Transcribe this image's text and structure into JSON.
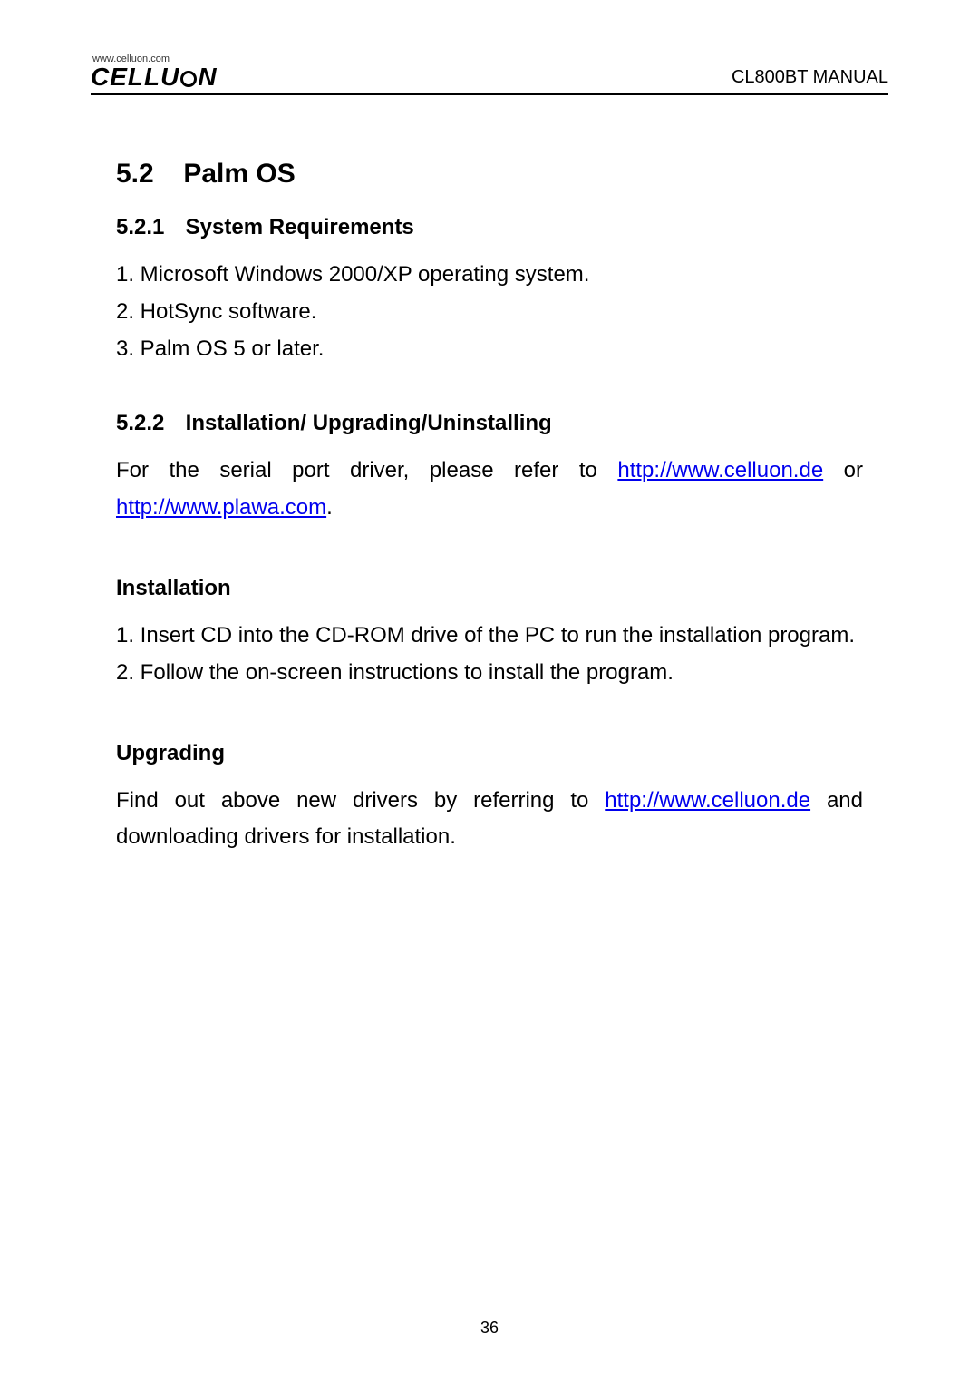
{
  "header": {
    "logo_url": "www.celluon.com",
    "logo_part1": "CELLU",
    "logo_part2": "N",
    "doc_title": "CL800BT MANUAL"
  },
  "section": {
    "number": "5.2",
    "title": "Palm OS"
  },
  "sub1": {
    "number": "5.2.1",
    "title": "System Requirements",
    "items": [
      "1. Microsoft Windows 2000/XP operating system.",
      "2. HotSync software.",
      "3. Palm OS 5 or later."
    ]
  },
  "sub2": {
    "number": "5.2.2",
    "title": "Installation/ Upgrading/Uninstalling",
    "intro_prefix": "For the serial port driver, please refer to ",
    "link1_text": "http://www.celluon.de",
    "intro_middle": " or ",
    "link2_text": "http://www.plawa.com",
    "intro_suffix": "."
  },
  "installation": {
    "heading": "Installation",
    "items": [
      "1. Insert CD into the CD-ROM drive of the PC to run the installation program.",
      "2. Follow the on-screen instructions to install the program."
    ]
  },
  "upgrading": {
    "heading": "Upgrading",
    "prefix": "Find out above new drivers by referring to ",
    "link_text": "http://www.celluon.de",
    "suffix": " and downloading drivers for installation."
  },
  "page_number": "36"
}
